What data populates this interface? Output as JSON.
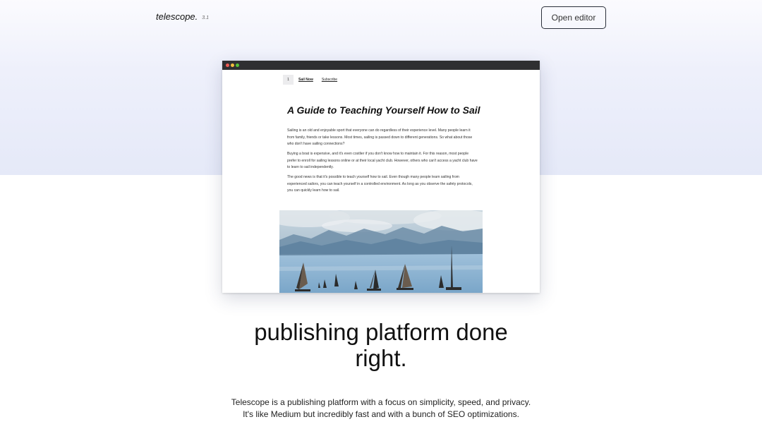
{
  "header": {
    "logo": "telescope.",
    "version": "3.1",
    "open_editor_label": "Open editor"
  },
  "preview": {
    "site_logo": "1",
    "nav": [
      "Sail Now",
      "Subscribe"
    ],
    "article": {
      "title": "A Guide to Teaching Yourself How to Sail",
      "paragraphs": [
        "Sailing is an old and enjoyable sport that everyone can do regardless of their experience level. Many people learn it from family, friends or take lessons. Most times, sailing is passed down to different generations. So what about those who don't have sailing connections?",
        "Buying a boat is expensive, and it's even costlier if you don't know how to maintain it. For this reason, most people prefer to enroll for sailing lessons online or at their local yacht club. However, others who can't access a yacht club have to learn to sail independently.",
        "The good news is that it's possible to teach yourself how to sail. Even though many people learn sailing from experienced sailors, you can teach yourself in a controlled environment. As long as you observe the safety protocols, you can quickly learn how to sail."
      ]
    }
  },
  "hero": {
    "headline_line1": "publishing platform done",
    "headline_line2": "right.",
    "description_line1": "Telescope is a publishing platform with a focus on simplicity, speed, and privacy.",
    "description_line2": "It's like Medium but incredibly fast and with a bunch of SEO optimizations."
  },
  "colors": {
    "top_band": "#e5e9f8",
    "browser_bar": "#2f2f31",
    "button_border": "#2a2f3a"
  }
}
